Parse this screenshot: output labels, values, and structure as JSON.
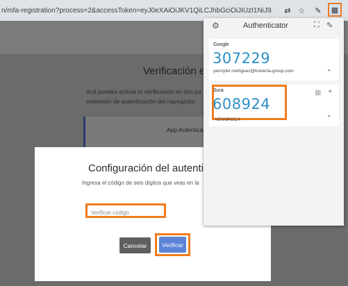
{
  "browser": {
    "url": "n/mfa-registration?process=2&accessToken=eyJ0eXAiOiJKV1QiLCJhbGciOiJIUzI1NiJ9.eyJleHAiOjE3MTI...",
    "icons": [
      "translate-icon",
      "star-icon",
      "extension-icon",
      "profile-icon",
      "authenticator-extension-icon"
    ]
  },
  "page": {
    "title": "Verificación en",
    "description": "Acá puedes activar la verificación en dos pa extensión de autenticación del navegador",
    "card_title": "App Autentica"
  },
  "modal": {
    "title": "Configuración del autentica",
    "subtitle": "Ingresa el código de seis dígitos que veas en la",
    "code_placeholder": "Verificar código",
    "cancel_label": "Cancelar",
    "verify_label": "Verificar"
  },
  "authenticator": {
    "title": "Authenticator",
    "accounts": [
      {
        "issuer": "Google",
        "code": "307229",
        "user": "yennyfer.rodriguez@konecta-group.com"
      },
      {
        "issuer": "Sura",
        "code": "608924",
        "user": "YENNROCA"
      }
    ]
  },
  "colors": {
    "highlight": "#f07b1d",
    "code_blue": "#2d8fc7",
    "verify_button": "#5b84d6"
  }
}
